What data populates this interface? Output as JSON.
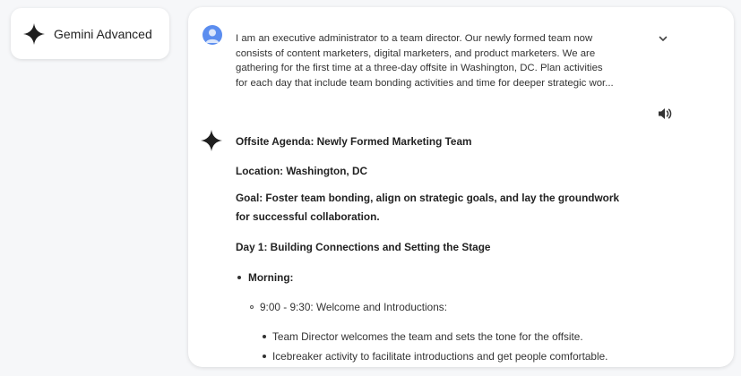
{
  "sidebar": {
    "badge_label": "Gemini Advanced",
    "badge_icon": "gemini-sparkle-icon"
  },
  "conversation": {
    "user_prompt_lines": [
      "I am an executive administrator to a team director. Our newly formed team now",
      "consists of content marketers, digital marketers, and product marketers. We are",
      "gathering for the first time at a three-day offsite in Washington, DC. Plan activities",
      "for each day that include team bonding activities and time for deeper strategic wor..."
    ],
    "user_avatar_icon": "user-avatar-icon",
    "expand_icon": "chevron-down-icon",
    "listen_icon": "speaker-icon",
    "response": {
      "title": "Offsite Agenda: Newly Formed Marketing Team",
      "location": "Location: Washington, DC",
      "goal_lines": [
        "Goal: Foster team bonding, align on strategic goals, and lay the groundwork",
        "for successful collaboration."
      ],
      "day1_heading": "Day 1: Building Connections and Setting the Stage",
      "morning_label": "Morning:",
      "session": "9:00 - 9:30: Welcome and Introductions:",
      "session_points": [
        "Team Director welcomes the team and sets the tone for the offsite.",
        "Icebreaker activity to facilitate introductions and get people comfortable."
      ]
    }
  },
  "colors": {
    "background": "#f6f7f9",
    "card": "#ffffff",
    "avatar_blue": "#5b8def",
    "text": "#1f1f1f"
  }
}
